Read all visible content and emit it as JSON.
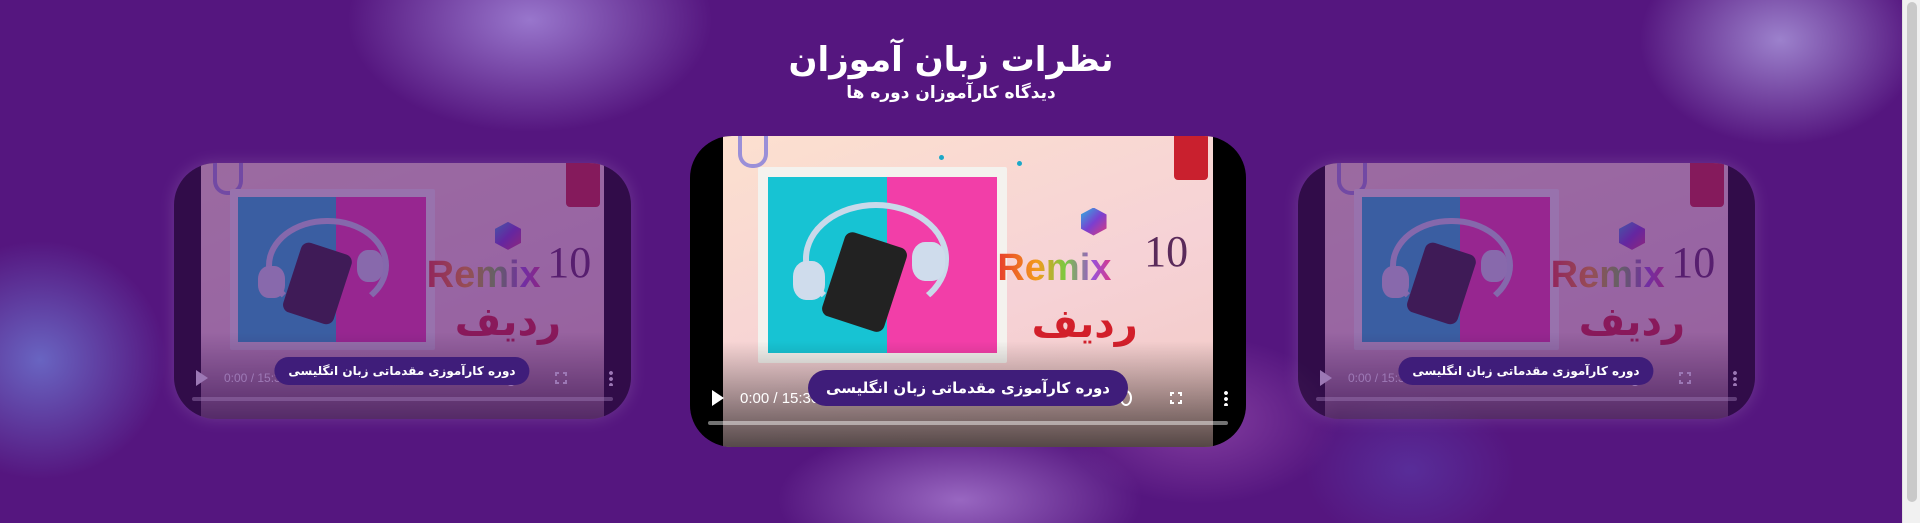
{
  "header": {
    "title": "نظرات زبان آموزان",
    "subtitle": "دیدگاه کارآموزان دوره ها"
  },
  "cards": [
    {
      "position": "left",
      "label": "دوره کارآموزی مقدماتی زبان انگلیسی",
      "time": "0:00 / 15:30",
      "poster": {
        "brand": "Remix",
        "number": "10",
        "title": "ردیف"
      }
    },
    {
      "position": "center",
      "label": "دوره کارآموزی مقدماتی زبان انگلیسی",
      "time": "0:00 / 15:30",
      "poster": {
        "brand": "Remix",
        "number": "10",
        "title": "ردیف"
      }
    },
    {
      "position": "right",
      "label": "دوره کارآموزی مقدماتی زبان انگلیسی",
      "time": "0:00 / 15:30",
      "poster": {
        "brand": "Remix",
        "number": "10",
        "title": "ردیف"
      }
    }
  ],
  "icons": {
    "play": "play-icon",
    "volume": "volume-icon",
    "fullscreen": "fullscreen-icon",
    "more": "more-options-icon"
  },
  "colors": {
    "background": "#55167f",
    "label_pill": "#3f1d7a"
  }
}
